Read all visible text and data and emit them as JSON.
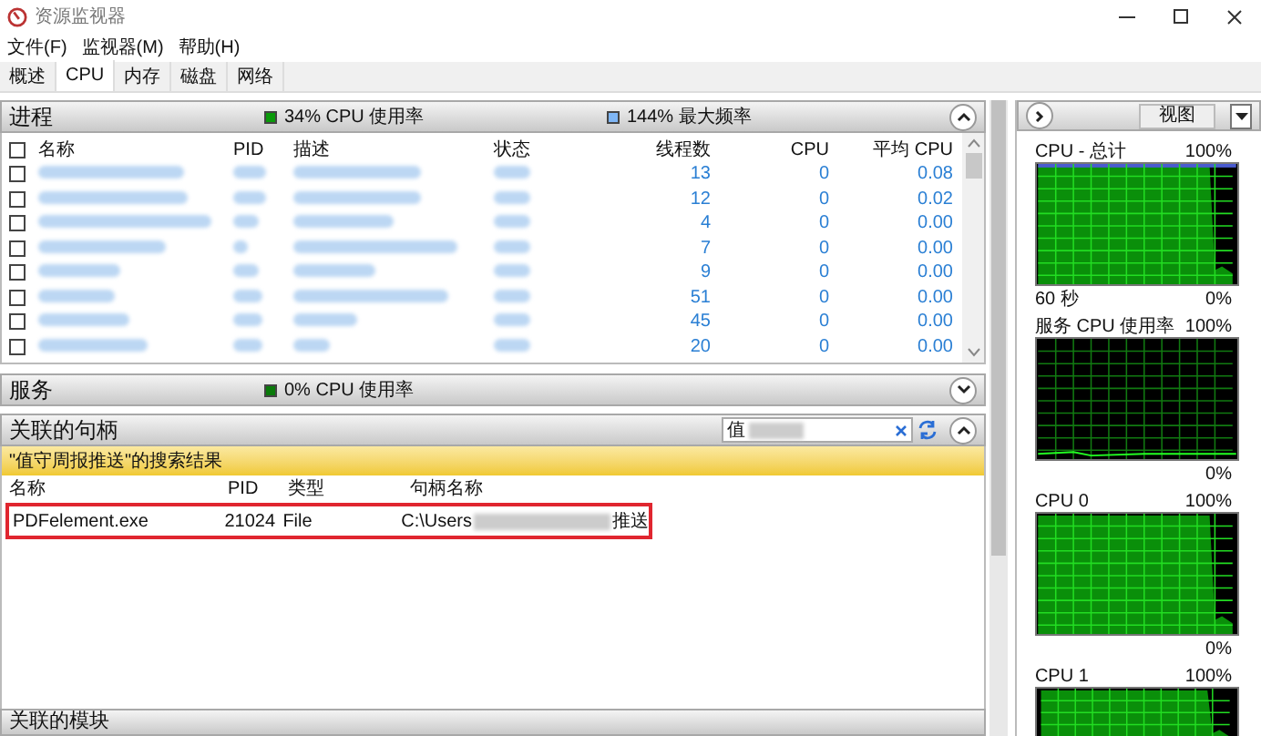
{
  "window": {
    "title": "资源监视器"
  },
  "menu": [
    "文件(F)",
    "监视器(M)",
    "帮助(H)"
  ],
  "tabs": [
    {
      "label": "概述",
      "selected": false
    },
    {
      "label": "CPU",
      "selected": true
    },
    {
      "label": "内存",
      "selected": false
    },
    {
      "label": "磁盘",
      "selected": false
    },
    {
      "label": "网络",
      "selected": false
    }
  ],
  "processes": {
    "title": "进程",
    "usage": "34% CPU 使用率",
    "frequency": "144% 最大频率",
    "expanded": true,
    "select_all_checked": false,
    "columns": [
      "名称",
      "PID",
      "描述",
      "状态",
      "线程数",
      "CPU",
      "平均 CPU"
    ],
    "rows": [
      {
        "checked": false,
        "threads": "13",
        "cpu": "0",
        "avg_cpu": "0.08"
      },
      {
        "checked": false,
        "threads": "12",
        "cpu": "0",
        "avg_cpu": "0.02"
      },
      {
        "checked": false,
        "threads": "4",
        "cpu": "0",
        "avg_cpu": "0.00"
      },
      {
        "checked": false,
        "threads": "7",
        "cpu": "0",
        "avg_cpu": "0.00"
      },
      {
        "checked": false,
        "threads": "9",
        "cpu": "0",
        "avg_cpu": "0.00"
      },
      {
        "checked": false,
        "threads": "51",
        "cpu": "0",
        "avg_cpu": "0.00"
      },
      {
        "checked": false,
        "threads": "45",
        "cpu": "0",
        "avg_cpu": "0.00"
      },
      {
        "checked": false,
        "threads": "20",
        "cpu": "0",
        "avg_cpu": "0.00"
      }
    ]
  },
  "services": {
    "title": "服务",
    "usage": "0% CPU 使用率",
    "expanded": false
  },
  "handles": {
    "title": "关联的句柄",
    "search_value": "值",
    "expanded": true,
    "result_banner": "\"值守周报推送\"的搜索结果",
    "columns": [
      "名称",
      "PID",
      "类型",
      "句柄名称"
    ],
    "rows": [
      {
        "name": "PDFelement.exe",
        "pid": "21024",
        "type": "File",
        "handle_start": "C:\\Users",
        "handle_end": "推送",
        "highlighted": true
      }
    ]
  },
  "modules": {
    "title": "关联的模块"
  },
  "side_panel": {
    "view_button": "视图",
    "graphs": [
      {
        "title": "CPU - 总计",
        "max": "100%",
        "min": "0%",
        "time": "60 秒",
        "kind": "busy"
      },
      {
        "title": "服务 CPU 使用率",
        "max": "100%",
        "min": "0%",
        "kind": "idle"
      },
      {
        "title": "CPU 0",
        "max": "100%",
        "min": "0%",
        "kind": "busy"
      },
      {
        "title": "CPU 1",
        "max": "100%",
        "kind": "busy"
      }
    ]
  }
}
